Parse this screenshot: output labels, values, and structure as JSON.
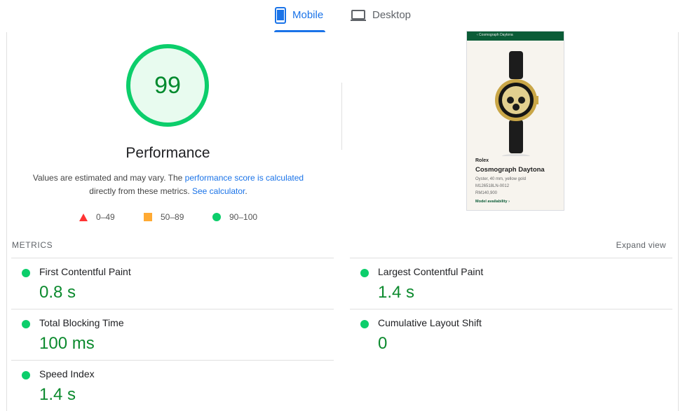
{
  "tabs": [
    {
      "label": "Mobile",
      "icon": "smartphone-icon",
      "active": true
    },
    {
      "label": "Desktop",
      "icon": "laptop-icon",
      "active": false
    }
  ],
  "colors": {
    "accent": "#1a73e8",
    "pass": "#0cce6b",
    "pass_text": "#0c8a2e",
    "average": "#ffaa33",
    "fail": "#ff3333"
  },
  "performance": {
    "score": "99",
    "title": "Performance",
    "desc_prefix": "Values are estimated and may vary. The ",
    "desc_link1": "performance score is calculated",
    "desc_middle": " directly from these metrics. ",
    "desc_link2": "See calculator",
    "desc_suffix": "."
  },
  "legend": {
    "fail": "0–49",
    "average": "50–89",
    "pass": "90–100"
  },
  "thumbnail": {
    "header": "‹ Cosmograph Daytona",
    "brand": "Rolex",
    "model": "Cosmograph Daytona",
    "line1": "Oyster, 40 mm, yellow gold",
    "line2": "M126518LN-0012",
    "line3": "RM140,900",
    "link": "Model availability ›"
  },
  "metrics": {
    "header": "METRICS",
    "expand": "Expand view",
    "fcp": {
      "name": "First Contentful Paint",
      "value": "0.8 s"
    },
    "lcp": {
      "name": "Largest Contentful Paint",
      "value": "1.4 s"
    },
    "tbt": {
      "name": "Total Blocking Time",
      "value": "100 ms"
    },
    "cls": {
      "name": "Cumulative Layout Shift",
      "value": "0"
    },
    "si": {
      "name": "Speed Index",
      "value": "1.4 s"
    }
  }
}
